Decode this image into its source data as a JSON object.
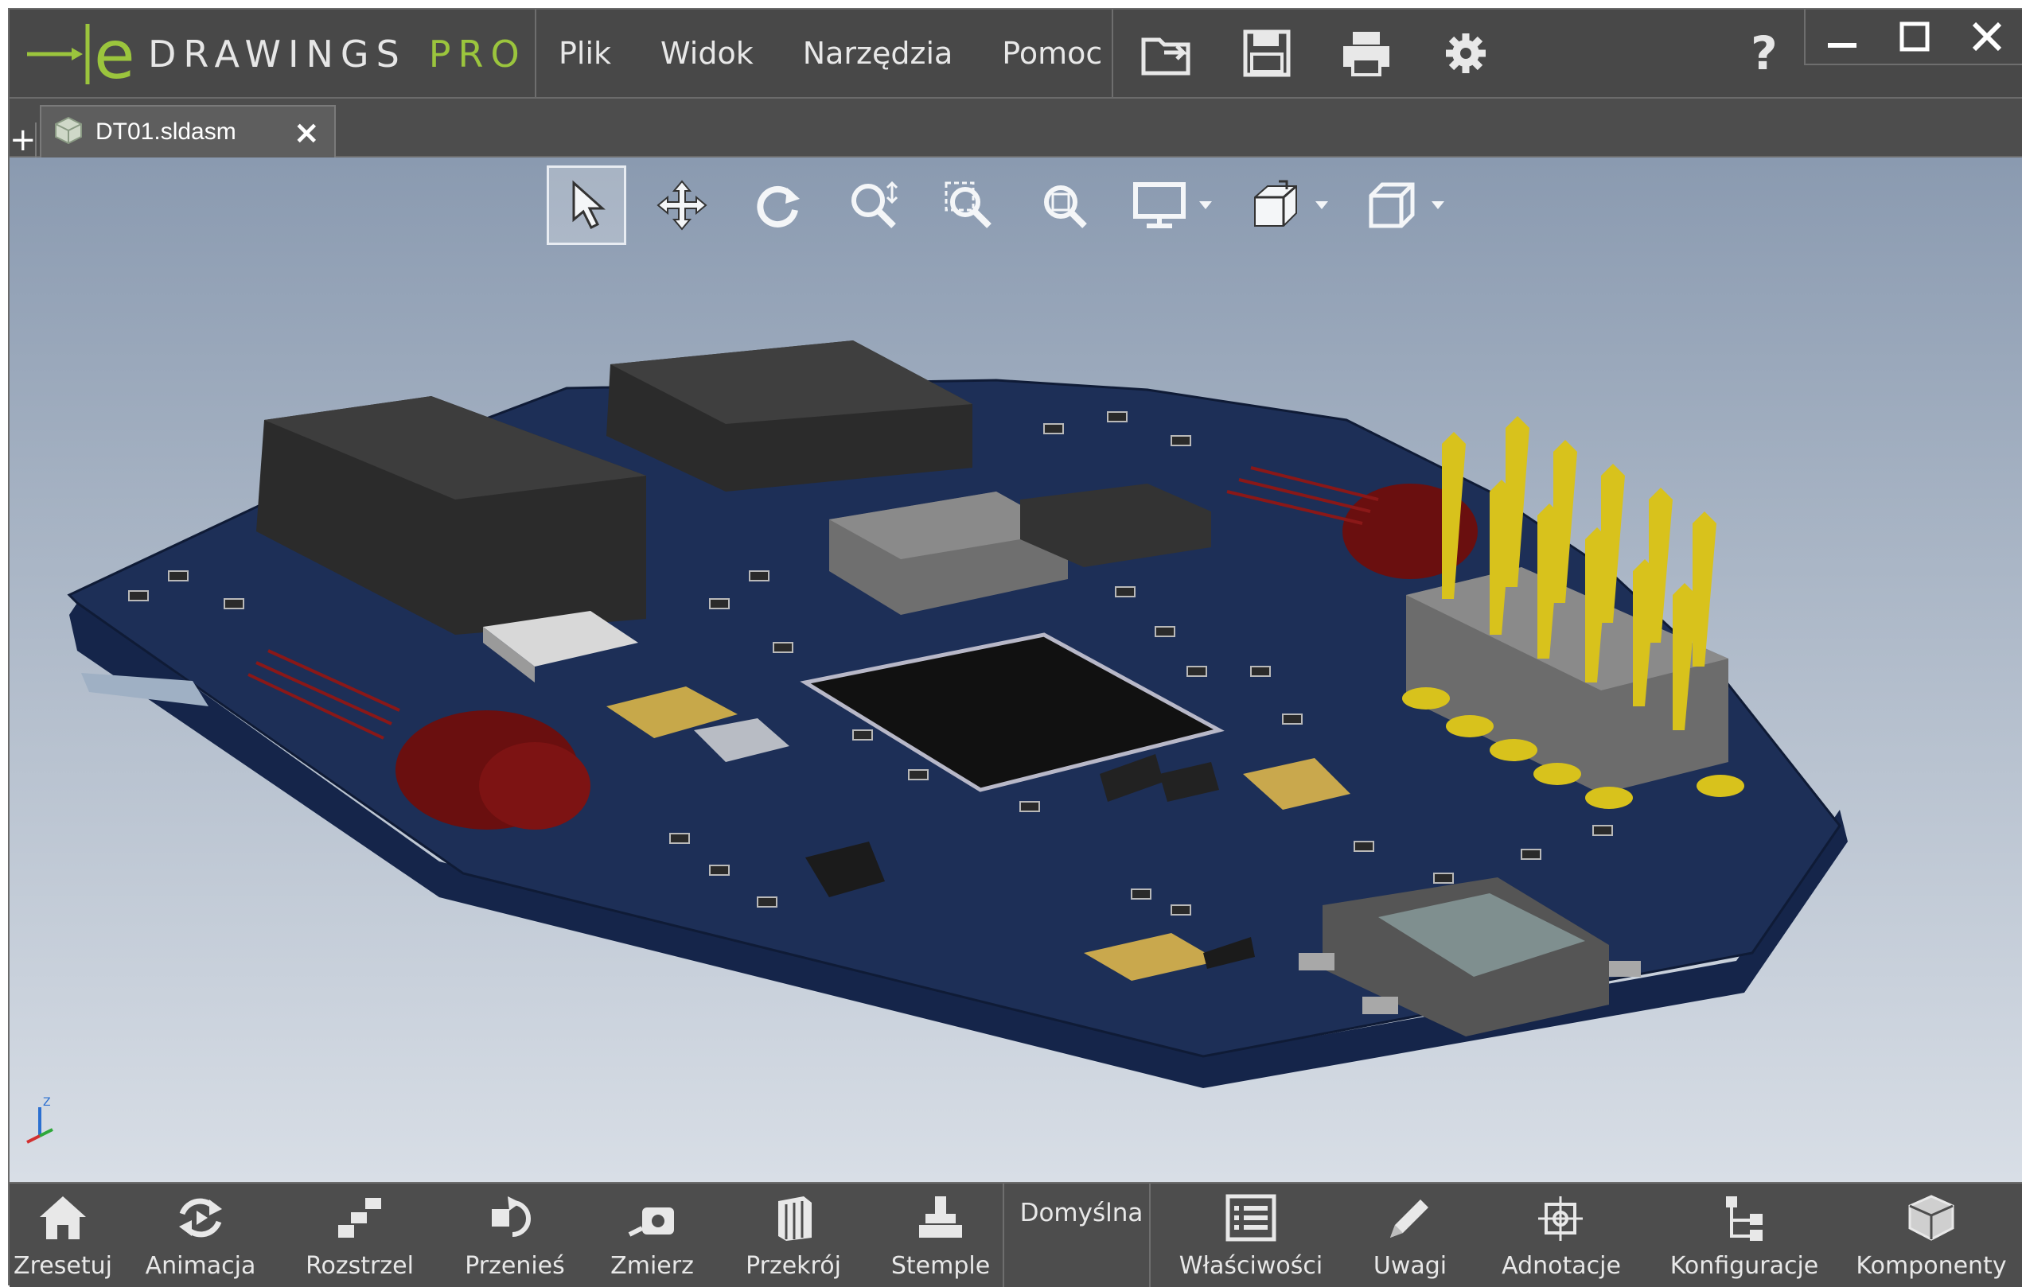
{
  "app": {
    "logo_letter": "e",
    "logo_text": "DRAWINGS",
    "logo_edition": "PRO",
    "brand_color": "#9bc53d"
  },
  "menu": {
    "items": [
      {
        "label": "Plik"
      },
      {
        "label": "Widok"
      },
      {
        "label": "Narzędzia"
      },
      {
        "label": "Pomoc"
      }
    ]
  },
  "toolbar_icons": [
    "open-icon",
    "save-icon",
    "print-icon",
    "settings-gear-icon"
  ],
  "help": {
    "label": "?"
  },
  "window_controls": [
    "minimize-icon",
    "maximize-icon",
    "close-icon"
  ],
  "tabs": {
    "new_tab_label": "+",
    "items": [
      {
        "label": "DT01.sldasm",
        "close_label": "×",
        "icon": "assembly-icon"
      }
    ]
  },
  "view_toolbar": {
    "tools": [
      "select-arrow-icon",
      "pan-icon",
      "rotate-icon",
      "zoom-icon",
      "zoom-window-icon",
      "zoom-to-fit-icon",
      "display-style-icon",
      "view-orientation-icon",
      "standard-views-icon"
    ],
    "active": "select-arrow-icon"
  },
  "bottom_toolbar": {
    "left": [
      {
        "label": "Zresetuj",
        "icon": "home-icon"
      },
      {
        "label": "Animacja",
        "icon": "animation-icon"
      },
      {
        "label": "Rozstrzel",
        "icon": "explode-icon"
      },
      {
        "label": "Przenieś",
        "icon": "move-icon"
      },
      {
        "label": "Zmierz",
        "icon": "measure-icon"
      },
      {
        "label": "Przekrój",
        "icon": "section-icon"
      },
      {
        "label": "Stemple",
        "icon": "stamp-icon"
      }
    ],
    "configuration": "Domyślna",
    "right": [
      {
        "label": "Właściwości",
        "icon": "properties-icon"
      },
      {
        "label": "Uwagi",
        "icon": "markup-pencil-icon"
      },
      {
        "label": "Adnotacje",
        "icon": "annotation-icon"
      },
      {
        "label": "Konfiguracje",
        "icon": "configurations-icon"
      },
      {
        "label": "Komponenty",
        "icon": "components-icon"
      }
    ]
  },
  "viewport": {
    "background_top": "#8a9ab0",
    "background_bottom": "#d8dee6",
    "model": "pcb-board-3d-model"
  }
}
